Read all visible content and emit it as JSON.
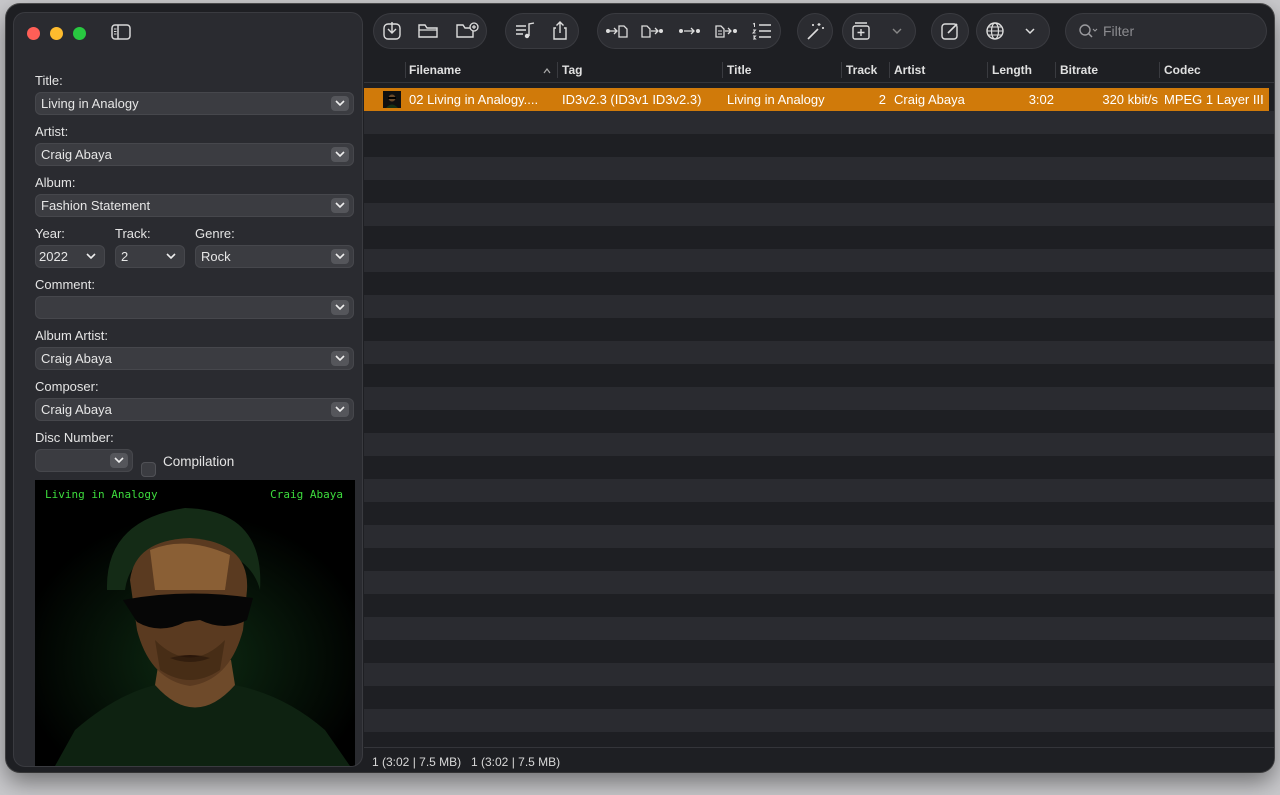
{
  "sidebar": {
    "title": {
      "label": "Title:",
      "value": "Living in Analogy"
    },
    "artist": {
      "label": "Artist:",
      "value": "Craig Abaya"
    },
    "album": {
      "label": "Album:",
      "value": "Fashion Statement"
    },
    "year": {
      "label": "Year:",
      "value": "2022"
    },
    "track": {
      "label": "Track:",
      "value": "2"
    },
    "genre": {
      "label": "Genre:",
      "value": "Rock"
    },
    "comment": {
      "label": "Comment:",
      "value": ""
    },
    "album_artist": {
      "label": "Album Artist:",
      "value": "Craig Abaya"
    },
    "composer": {
      "label": "Composer:",
      "value": "Craig Abaya"
    },
    "disc_number": {
      "label": "Disc Number:",
      "value": ""
    },
    "compilation": {
      "label": "Compilation",
      "checked": false
    },
    "artwork": {
      "left_text": "Living in Analogy",
      "right_text": "Craig Abaya"
    }
  },
  "toolbar": {
    "search_placeholder": "Filter",
    "icons": [
      "import-icon",
      "folder-icon",
      "new-folder-icon",
      "playlist-icon",
      "share-icon",
      "tag-to-filename-icon",
      "filename-to-tag-icon",
      "tag-to-tag-icon",
      "text-to-tag-icon",
      "numbering-icon",
      "magic-wand-icon",
      "add-tag-icon",
      "chevron-down-icon",
      "edit-icon",
      "globe-icon",
      "chevron-down-icon"
    ]
  },
  "table": {
    "columns": [
      "Filename",
      "Tag",
      "Title",
      "Track",
      "Artist",
      "Length",
      "Bitrate",
      "Codec"
    ],
    "rows": [
      {
        "filename": "02 Living in Analogy....",
        "tag": "ID3v2.3 (ID3v1 ID3v2.3)",
        "title": "Living in Analogy",
        "track": "2",
        "artist": "Craig Abaya",
        "length": "3:02",
        "bitrate": "320 kbit/s",
        "codec": "MPEG 1 Layer III"
      }
    ]
  },
  "status": {
    "selection": "1 (3:02 | 7.5 MB)",
    "total": "1 (3:02 | 7.5 MB)"
  },
  "colors": {
    "accent": "#d07a0a",
    "window_bg": "#1e1f23",
    "sidebar_bg": "#2a2b30"
  }
}
